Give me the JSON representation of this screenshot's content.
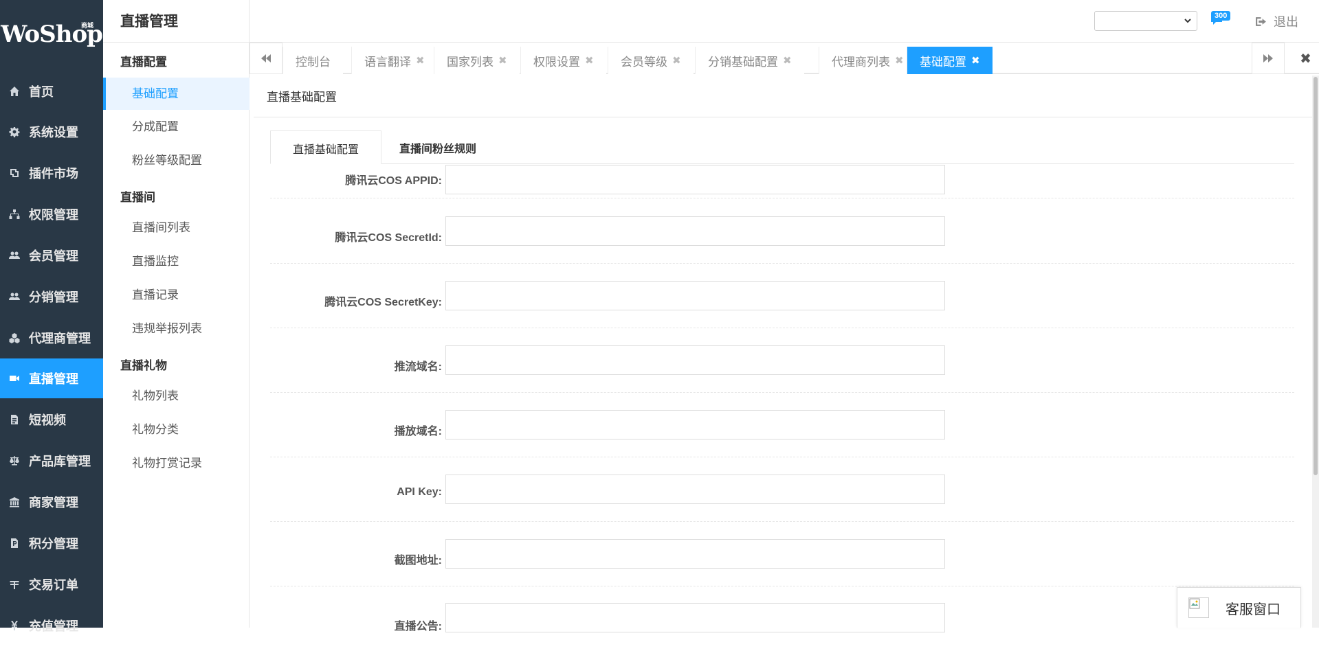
{
  "logo": {
    "text": "WoShop",
    "badge": "商城"
  },
  "sidebar": {
    "items": [
      {
        "label": "首页",
        "icon": "home-icon"
      },
      {
        "label": "系统设置",
        "icon": "gear-icon"
      },
      {
        "label": "插件市场",
        "icon": "plugin-icon"
      },
      {
        "label": "权限管理",
        "icon": "sitemap-icon"
      },
      {
        "label": "会员管理",
        "icon": "users-icon"
      },
      {
        "label": "分销管理",
        "icon": "users-icon"
      },
      {
        "label": "代理商管理",
        "icon": "cubes-icon"
      },
      {
        "label": "直播管理",
        "icon": "video-camera-icon"
      },
      {
        "label": "短视频",
        "icon": "file-icon"
      },
      {
        "label": "产品库管理",
        "icon": "balance-scale-icon"
      },
      {
        "label": "商家管理",
        "icon": "bank-icon"
      },
      {
        "label": "积分管理",
        "icon": "file-icon"
      },
      {
        "label": "交易订单",
        "icon": "yen-icon"
      },
      {
        "label": "充值管理",
        "icon": "yen-icon"
      }
    ]
  },
  "submenu": {
    "title": "直播管理",
    "groups": [
      {
        "label": "直播配置",
        "items": [
          "基础配置",
          "分成配置",
          "粉丝等级配置"
        ]
      },
      {
        "label": "直播间",
        "items": [
          "直播间列表",
          "直播监控",
          "直播记录",
          "违规举报列表"
        ]
      },
      {
        "label": "直播礼物",
        "items": [
          "礼物列表",
          "礼物分类",
          "礼物打赏记录"
        ]
      }
    ]
  },
  "header": {
    "language_value": "",
    "message_count": "300",
    "logout_label": "退出"
  },
  "tabs": [
    {
      "label": "控制台"
    },
    {
      "label": "语言翻译"
    },
    {
      "label": "国家列表"
    },
    {
      "label": "权限设置"
    },
    {
      "label": "会员等级"
    },
    {
      "label": "分销基础配置"
    },
    {
      "label": "代理商列表"
    },
    {
      "label": "基础配置"
    }
  ],
  "content": {
    "title": "直播基础配置",
    "inner_tabs": [
      "直播基础配置",
      "直播间粉丝规则"
    ],
    "fields": [
      {
        "label": "腾讯云COS APPID:",
        "value": ""
      },
      {
        "label": "腾讯云COS SecretId:",
        "value": ""
      },
      {
        "label": "腾讯云COS SecretKey:",
        "value": ""
      },
      {
        "label": "推流域名:",
        "value": ""
      },
      {
        "label": "播放域名:",
        "value": ""
      },
      {
        "label": "API Key:",
        "value": ""
      },
      {
        "label": "截图地址:",
        "value": ""
      },
      {
        "label": "直播公告:",
        "value": ""
      }
    ]
  },
  "customer_service": {
    "label": "客服窗口"
  },
  "colors": {
    "sidebar_bg": "#293846",
    "accent": "#1e9fff"
  }
}
